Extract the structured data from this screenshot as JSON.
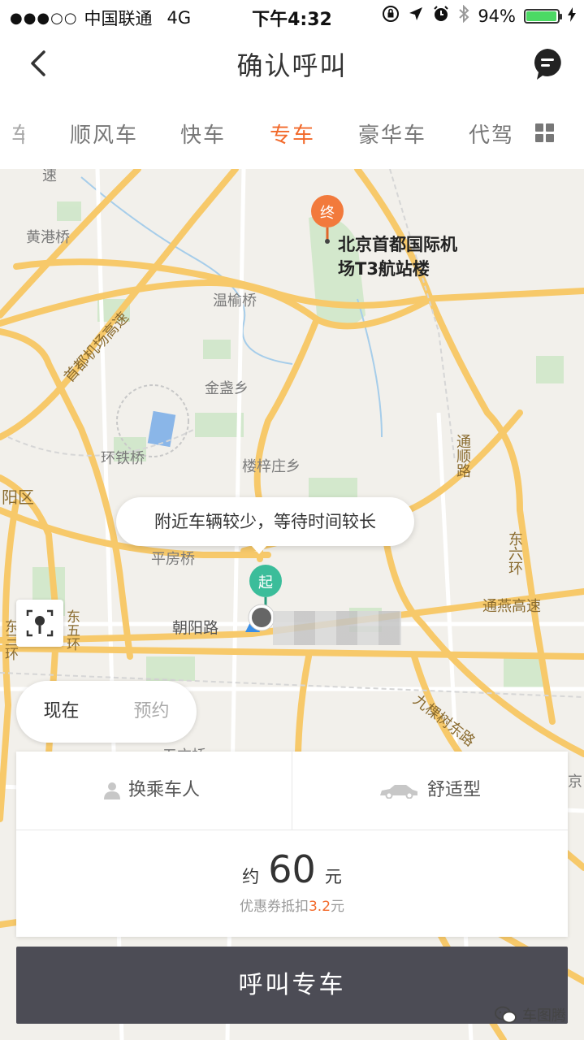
{
  "status_bar": {
    "signal_dots": "●●●○○",
    "carrier": "中国联通",
    "network": "4G",
    "time": "下午4:32",
    "battery": "94%",
    "battery_level": 0.94,
    "battery_color": "#4cd964"
  },
  "header": {
    "title": "确认呼叫",
    "back_icon": "chevron-left-icon",
    "message_icon": "message-bubble-icon"
  },
  "tabs": {
    "partial": "车",
    "items": [
      {
        "label": "顺风车",
        "active": false
      },
      {
        "label": "快车",
        "active": false
      },
      {
        "label": "专车",
        "active": true
      },
      {
        "label": "豪华车",
        "active": false
      },
      {
        "label": "代驾",
        "active": false
      }
    ],
    "more_icon": "grid-icon",
    "accent_color": "#f26a2b"
  },
  "map": {
    "labels": {
      "top_road": "速",
      "huanggang": "黄港桥",
      "wenyu": "温榆桥",
      "airport_expressway": "首都机场高速",
      "jinzhan": "金盏乡",
      "huantie": "环铁桥",
      "louzizhuang": "楼梓庄乡",
      "chaoyang_district": "阳区",
      "tongshun": "通顺路",
      "east_sixth_ring": "东六环",
      "pingfang": "平房桥",
      "chaoyang_road": "朝阳路",
      "tongyan": "通燕高速",
      "jiukeshu": "九棵树东路",
      "east_fifth_ring_partial": "东五环",
      "east_third_partial": "东三环",
      "wuzi": "五方桥",
      "right_edge": "京"
    },
    "destination": {
      "pin_label": "终",
      "name_line1": "北京首都国际机",
      "name_line2": "场T3航站楼",
      "pin_color": "#f27a3c"
    },
    "start": {
      "pin_label": "起",
      "pin_color": "#3bbd9a"
    },
    "tooltip": "附近车辆较少，等待时间较长",
    "locate_icon": "locate-icon"
  },
  "time_toggle": {
    "now": "现在",
    "reserve": "预约",
    "selected": "现在"
  },
  "order": {
    "passenger_label": "换乘车人",
    "passenger_icon": "person-icon",
    "car_type_label": "舒适型",
    "car_icon": "car-icon",
    "price_prefix": "约",
    "price": "60",
    "price_unit": "元",
    "coupon_prefix": "优惠券抵扣",
    "coupon_amount": "3.2",
    "coupon_unit": "元"
  },
  "call_button": "呼叫专车",
  "watermark": "车图腾"
}
